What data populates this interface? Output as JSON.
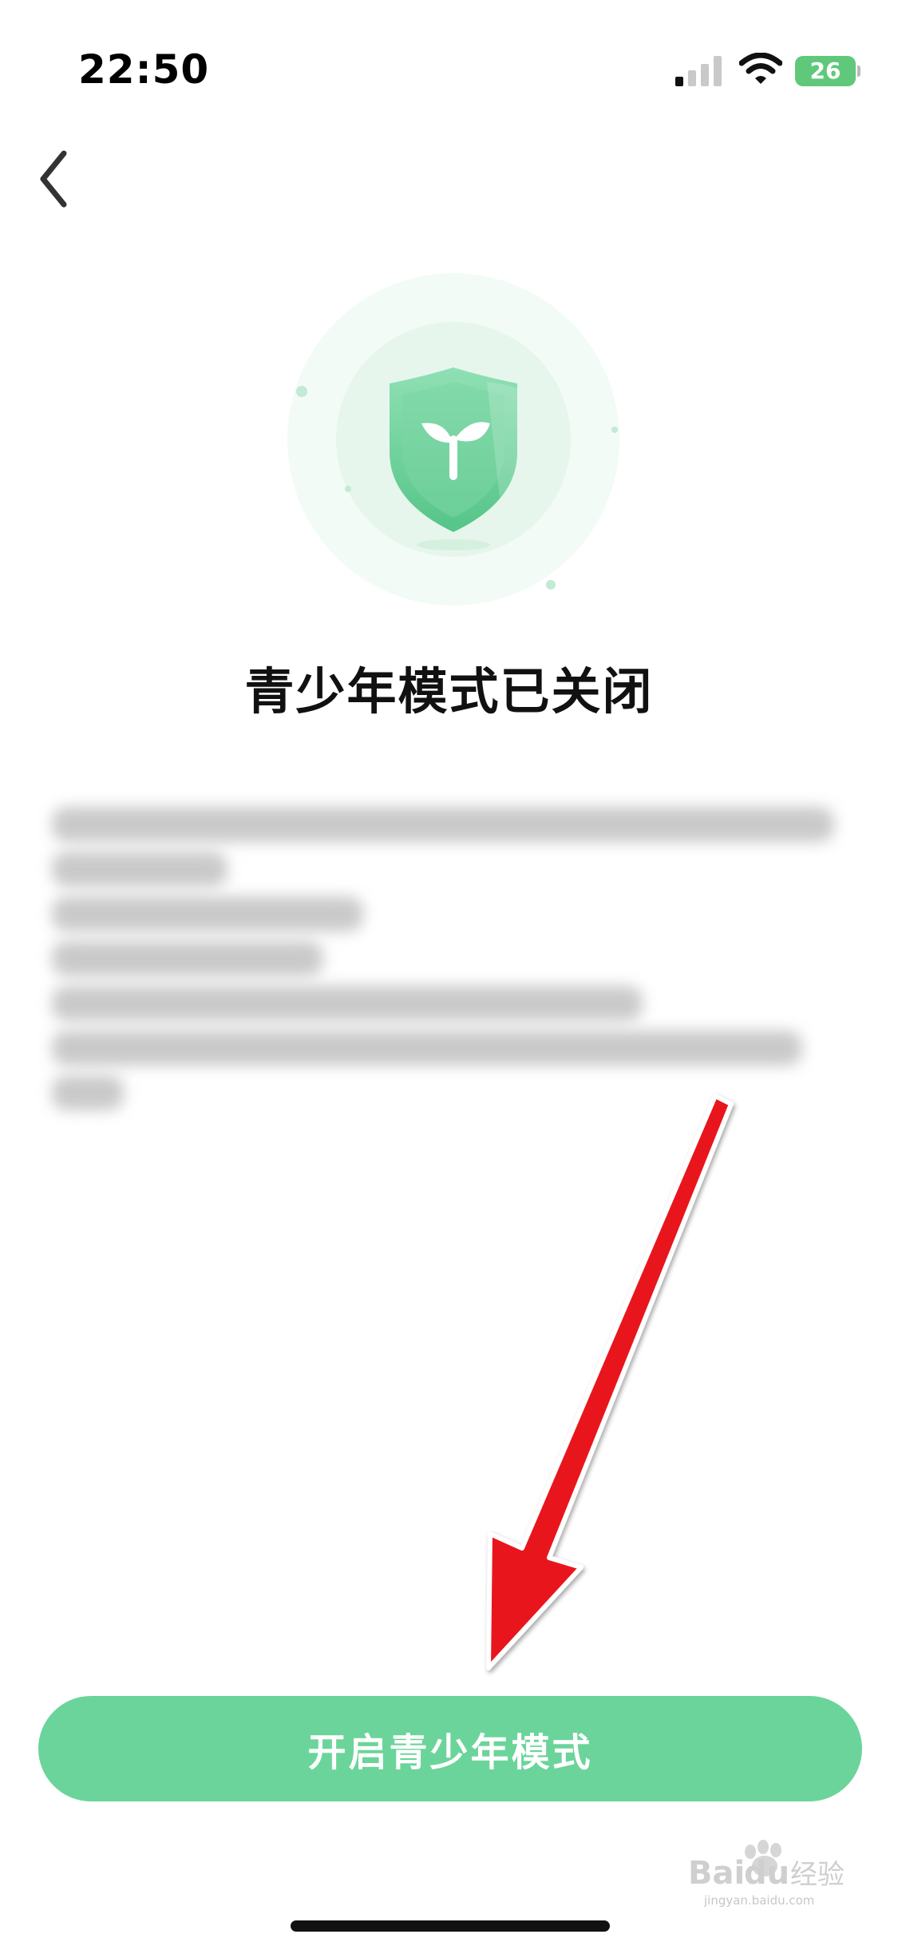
{
  "status_bar": {
    "time": "22:50",
    "battery": "26",
    "icons": [
      "signal-icon",
      "wifi-icon",
      "battery-charging-icon"
    ]
  },
  "header": {
    "back_icon": "chevron-left-icon"
  },
  "hero": {
    "icon": "shield-sprout-icon",
    "accent_color": "#6bd49a"
  },
  "main": {
    "title": "青少年模式已关闭"
  },
  "action": {
    "button_label": "开启青少年模式",
    "color": "#6bd49a"
  },
  "annotation": {
    "arrow_color": "#e8141a"
  },
  "watermark": {
    "brand": "Baidu经验",
    "url": "jingyan.baidu.com"
  }
}
